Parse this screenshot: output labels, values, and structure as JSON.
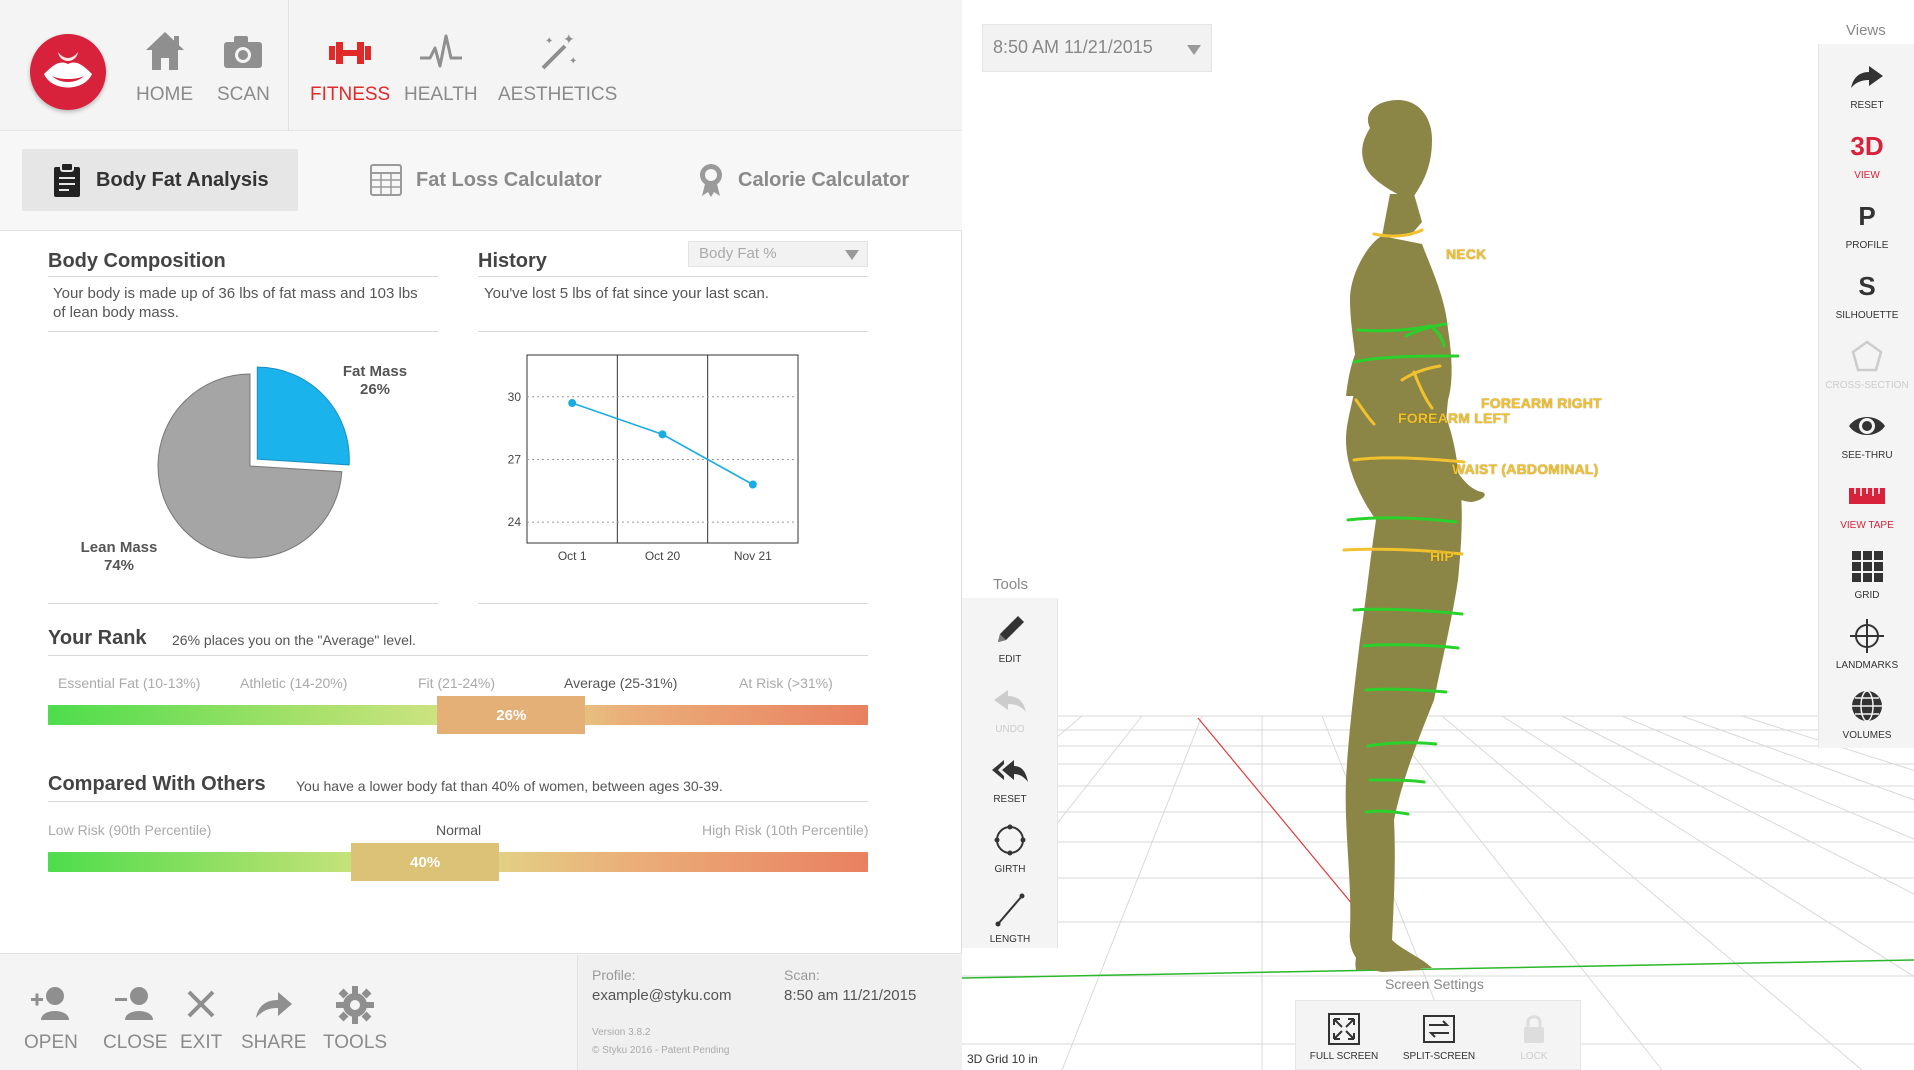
{
  "nav": {
    "items": [
      {
        "label": "HOME",
        "icon": "home-icon"
      },
      {
        "label": "SCAN",
        "icon": "camera-icon"
      },
      {
        "label": "FITNESS",
        "icon": "dumbbell-icon"
      },
      {
        "label": "HEALTH",
        "icon": "heartbeat-icon"
      },
      {
        "label": "AESTHETICS",
        "icon": "magic-wand-icon"
      }
    ],
    "active": "FITNESS"
  },
  "tabs": [
    {
      "label": "Body Fat Analysis",
      "icon": "clipboard-icon"
    },
    {
      "label": "Fat Loss Calculator",
      "icon": "calculator-icon"
    },
    {
      "label": "Calorie Calculator",
      "icon": "award-icon"
    }
  ],
  "composition": {
    "title": "Body Composition",
    "desc": "Your body is made up of 36 lbs of fat mass and 103 lbs of lean body mass.",
    "fat_label": "Fat Mass",
    "fat_pct": "26%",
    "lean_label": "Lean Mass",
    "lean_pct": "74%"
  },
  "history": {
    "title": "History",
    "select_value": "Body Fat %",
    "desc": "You've lost 5 lbs of fat since your last scan."
  },
  "chart_data": {
    "type": "line",
    "x": [
      "Oct 1",
      "Oct 20",
      "Nov 21"
    ],
    "series": [
      {
        "values": [
          29.7,
          28.2,
          25.8
        ]
      }
    ],
    "ylim": [
      23,
      32
    ],
    "yticks": [
      24,
      27,
      30
    ],
    "color": "#1aace3"
  },
  "rank": {
    "title": "Your Rank",
    "desc": "26% places you on the \"Average\" level.",
    "levels": [
      "Essential Fat (10-13%)",
      "Athletic (14-20%)",
      "Fit (21-24%)",
      "Average (25-31%)",
      "At Risk (>31%)"
    ],
    "marker": "26%",
    "marker_position": 0.565
  },
  "compare": {
    "title": "Compared With Others",
    "desc": "You have a lower body fat than 40% of women, between ages 30-39.",
    "low_label": "Low Risk (90th Percentile)",
    "mid_label": "Normal",
    "high_label": "High Risk (10th Percentile)",
    "marker": "40%",
    "marker_position": 0.46
  },
  "bottom": {
    "items": [
      {
        "label": "OPEN",
        "icon": "add-user-icon"
      },
      {
        "label": "CLOSE",
        "icon": "remove-user-icon"
      },
      {
        "label": "EXIT",
        "icon": "close-icon"
      },
      {
        "label": "SHARE",
        "icon": "share-icon"
      },
      {
        "label": "TOOLS",
        "icon": "gear-icon"
      }
    ],
    "profile_label": "Profile:",
    "profile_value": "example@styku.com",
    "scan_label": "Scan:",
    "scan_value": "8:50 am 11/21/2015",
    "version": "Version 3.8.2",
    "copyright": "© Styku 2016 - Patent Pending"
  },
  "viewer": {
    "date": "8:50 AM 11/21/2015",
    "views_title": "Views",
    "views": [
      {
        "label": "RESET",
        "icon": "redo-arrow-icon"
      },
      {
        "label": "VIEW",
        "glyph": "3D"
      },
      {
        "label": "PROFILE",
        "glyph": "P"
      },
      {
        "label": "SILHOUETTE",
        "glyph": "S"
      },
      {
        "label": "CROSS-SECTION",
        "icon": "pentagon-icon"
      },
      {
        "label": "SEE-THRU",
        "icon": "eye-icon"
      },
      {
        "label": "VIEW TAPE",
        "icon": "tape-icon"
      },
      {
        "label": "GRID",
        "icon": "grid-icon"
      },
      {
        "label": "LANDMARKS",
        "icon": "crosshair-icon"
      },
      {
        "label": "VOLUMES",
        "icon": "globe-icon"
      }
    ],
    "tools_title": "Tools",
    "tools": [
      {
        "label": "EDIT",
        "icon": "pencil-icon"
      },
      {
        "label": "UNDO",
        "icon": "undo-icon"
      },
      {
        "label": "RESET",
        "icon": "reply-all-icon"
      },
      {
        "label": "GIRTH",
        "icon": "girth-icon"
      },
      {
        "label": "LENGTH",
        "icon": "length-icon"
      }
    ],
    "screen_settings_title": "Screen Settings",
    "screen_settings": [
      {
        "label": "FULL SCREEN",
        "icon": "fullscreen-icon"
      },
      {
        "label": "SPLIT-SCREEN",
        "icon": "split-screen-icon"
      },
      {
        "label": "LOCK",
        "icon": "lock-icon"
      }
    ],
    "grid_label": "3D Grid 10 in",
    "measurements": [
      "NECK",
      "FOREARM RIGHT",
      "FOREARM LEFT",
      "WAIST (ABDOMINAL)",
      "HIP"
    ],
    "colors": {
      "accent": "#d8213a",
      "body": "#8c8646",
      "tape_green": "#29d12a",
      "tape_yellow": "#f2c12e"
    }
  }
}
